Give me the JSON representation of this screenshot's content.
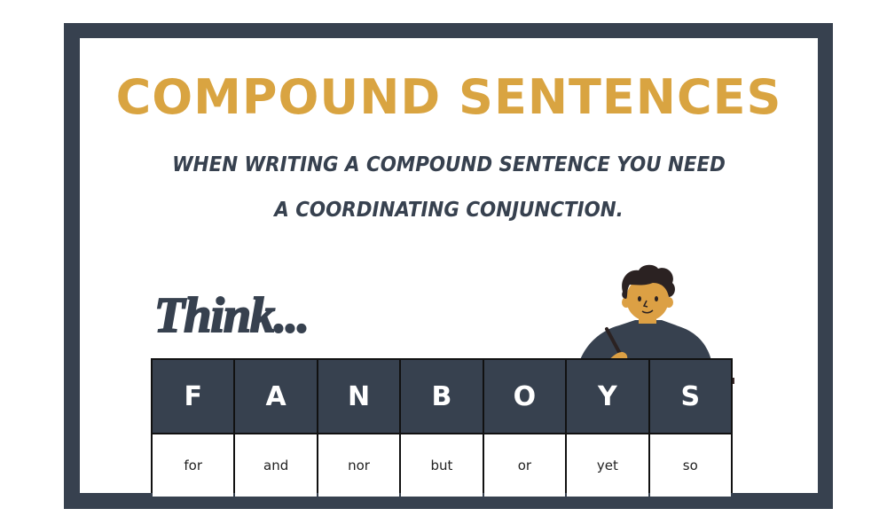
{
  "colors": {
    "frame": "#37414f",
    "title": "#d9a441",
    "header_cell": "#37414f",
    "desk": "#3a2a2a",
    "skin": "#dca044",
    "sweater": "#37414f",
    "hair": "#2b2222"
  },
  "title": "COMPOUND SENTENCES",
  "subtitle": {
    "line1": "WHEN WRITING A COMPOUND SENTENCE YOU NEED",
    "line2": "A COORDINATING CONJUNCTION."
  },
  "think_label": "Think...",
  "illustration": {
    "icon": "student-writing-at-desk-icon"
  },
  "fanboys": [
    {
      "letter": "F",
      "word": "for"
    },
    {
      "letter": "A",
      "word": "and"
    },
    {
      "letter": "N",
      "word": "nor"
    },
    {
      "letter": "B",
      "word": "but"
    },
    {
      "letter": "O",
      "word": "or"
    },
    {
      "letter": "Y",
      "word": "yet"
    },
    {
      "letter": "S",
      "word": "so"
    }
  ]
}
